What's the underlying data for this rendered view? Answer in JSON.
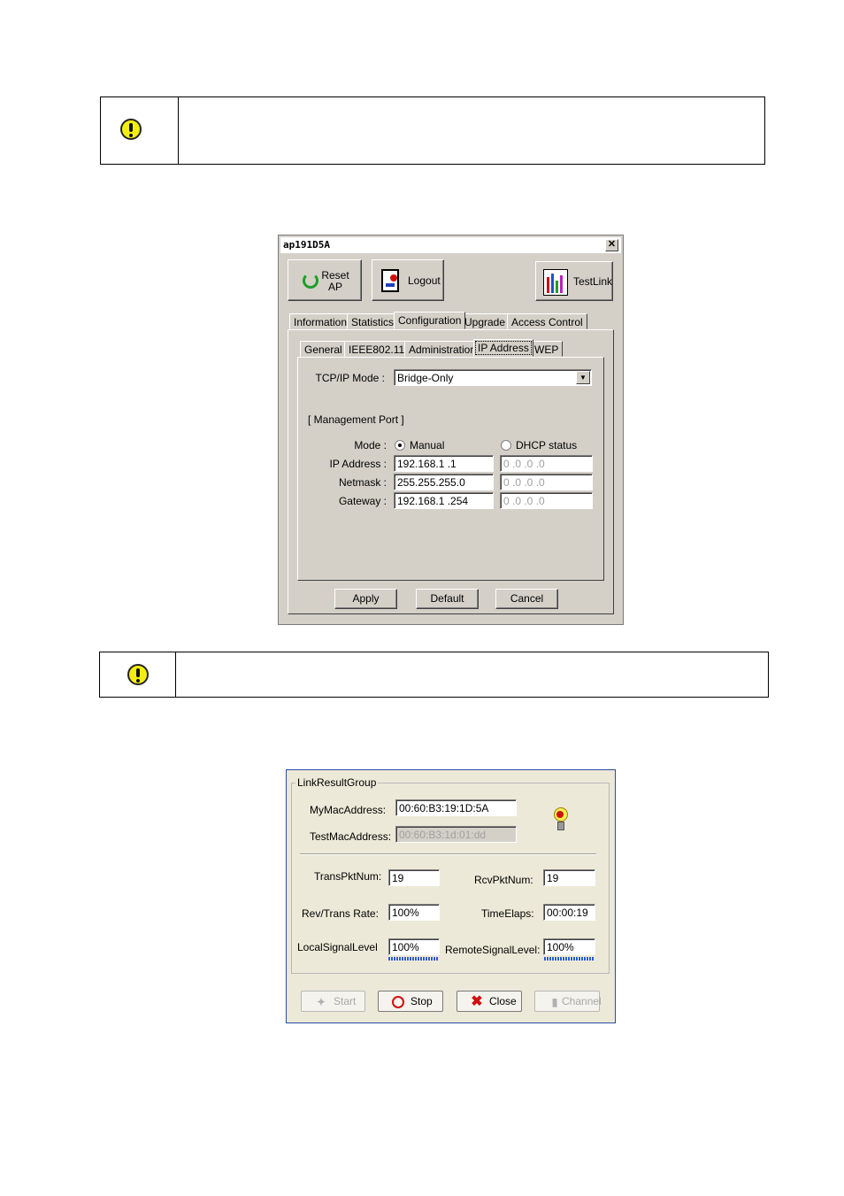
{
  "dialog1": {
    "title": "ap191D5A",
    "close_glyph": "✕",
    "toolbar": {
      "reset_label_line1": "Reset",
      "reset_label_line2": "AP",
      "logout_label": "Logout",
      "testlink_label": "TestLink"
    },
    "tabs": [
      "Information",
      "Statistics",
      "Configuration",
      "Upgrade",
      "Access Control"
    ],
    "active_tab": "Configuration",
    "subtabs": [
      "General",
      "IEEE802.11",
      "Administration",
      "IP Address",
      "WEP"
    ],
    "active_subtab": "IP Address",
    "tcpip_mode_label": "TCP/IP Mode :",
    "tcpip_mode_value": "Bridge-Only",
    "management_port_label": "[ Management Port ]",
    "mode_label": "Mode :",
    "mode_manual": "Manual",
    "mode_dhcp": "DHCP status",
    "mode_selected": "Manual",
    "ip_label": "IP Address :",
    "netmask_label": "Netmask :",
    "gateway_label": "Gateway :",
    "manual_ip": "192.168.1  .1",
    "manual_netmask": "255.255.255.0",
    "manual_gateway": "192.168.1  .254",
    "dhcp_ip": "0  .0  .0  .0",
    "dhcp_netmask": "0  .0  .0  .0",
    "dhcp_gateway": "0  .0  .0  .0",
    "apply_label": "Apply",
    "default_label": "Default",
    "cancel_label": "Cancel"
  },
  "dialog2": {
    "group_title": "LinkResultGroup",
    "my_mac_label": "MyMacAddress:",
    "my_mac_value": "00:60:B3:19:1D:5A",
    "test_mac_label": "TestMacAddress:",
    "test_mac_value": "00:60:B3:1d:01:dd",
    "trans_pkt_label": "TransPktNum:",
    "trans_pkt_value": "19",
    "rcv_pkt_label": "RcvPktNum:",
    "rcv_pkt_value": "19",
    "rate_label": "Rev/Trans Rate:",
    "rate_value": "100%",
    "time_label": "TimeElaps:",
    "time_value": "00:00:19",
    "local_signal_label": "LocalSignalLevel",
    "local_signal_value": "100%",
    "remote_signal_label": "RemoteSignalLevel:",
    "remote_signal_value": "100%",
    "start_label": "Start",
    "stop_label": "Stop",
    "close_label": "Close",
    "channel_label": "Channel"
  },
  "colors": {
    "dialog_bg": "#d4d0c8",
    "xp_bg": "#ece9d8",
    "warning_yellow": "#f4ee10",
    "meter_blue": "#3157c9"
  }
}
